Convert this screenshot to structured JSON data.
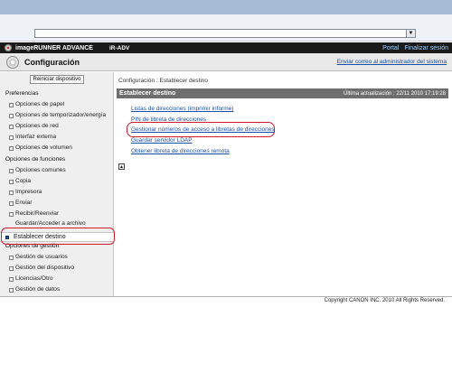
{
  "browser": {
    "dropdown_arrow": "▼"
  },
  "brandbar": {
    "product": "imageRUNNER ADVANCE",
    "device": "iR-ADV",
    "portal": "Portal",
    "logout": "Finalizar sesión"
  },
  "header": {
    "title": "Configuración",
    "mail_admin": "Enviar correo al administrador del sistema"
  },
  "sidebar": {
    "restart": "Reiniciar dispositivo",
    "prefs_header": "Preferencias",
    "prefs_items": [
      "Opciones de papel",
      "Opciones de temporizador/energía",
      "Opciones de red",
      "Interfaz externa",
      "Opciones de volumen"
    ],
    "func_header": "Opciones de funciones",
    "func_items": [
      "Opciones comunes",
      "Copia",
      "Impresora",
      "Enviar",
      "Recibir/Reenviar",
      "Guardar/Acceder a archivo"
    ],
    "active": "Establecer destino",
    "mgmt_header": "Opciones de gestión",
    "mgmt_items": [
      "Gestión de usuarios",
      "Gestión del dispositivo",
      "Licencias/Otro",
      "Gestión de datos"
    ]
  },
  "content": {
    "breadcrumb": "Configuración : Establecer destino",
    "section_title": "Establecer destino",
    "last_update": "Última actualización : 22/11 2010 17:19:28",
    "links": [
      "Listas de direcciones (imprimir informe)",
      "PIN de libreta de direcciones",
      "Gestionar números de acceso a libretas de direcciones",
      "Guardar servidor LDAP",
      "Obtener libreta de direcciones remota"
    ],
    "top_icon": "▲"
  },
  "footer": {
    "copyright": "Copyright CANON INC. 2010 All Rights Reserved."
  },
  "colors": {
    "highlight_ring": "#d01b2a",
    "link": "#1a4fa8",
    "brandbar": "#1a1a1a",
    "section_bar": "#6e6e6e"
  }
}
